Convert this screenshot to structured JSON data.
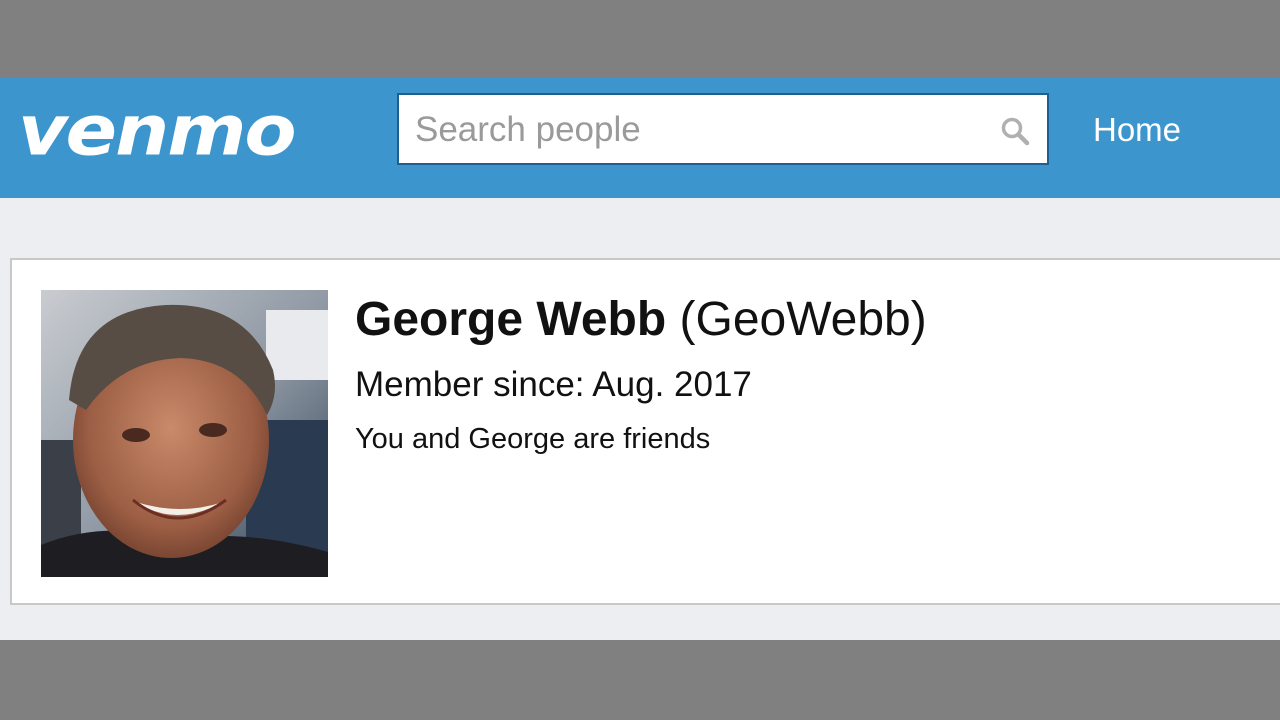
{
  "header": {
    "logo_text": "venmo",
    "search": {
      "placeholder": "Search people",
      "value": ""
    },
    "nav": {
      "home_label": "Home"
    }
  },
  "profile": {
    "display_name": "George Webb",
    "username": "(GeoWebb)",
    "member_since": "Member since: Aug. 2017",
    "friend_status": "You and George are friends"
  },
  "colors": {
    "brand_blue": "#3d95ce",
    "page_background": "#eceef2",
    "card_border": "#c8c8c8"
  },
  "icons": {
    "search": "search-icon"
  }
}
